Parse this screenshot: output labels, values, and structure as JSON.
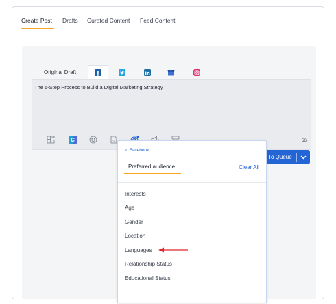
{
  "topnav": {
    "tabs": [
      "Create Post",
      "Drafts",
      "Curated Content",
      "Feed Content"
    ]
  },
  "composer": {
    "original_draft_label": "Original Draft",
    "networks": [
      "facebook-icon",
      "twitter-icon",
      "linkedin-icon",
      "google-my-business-icon",
      "instagram-icon"
    ],
    "post_text": "The 6-Step Process to Build a Digital Marketing Strategy",
    "char_count": "56",
    "toolbar_icons": [
      "media-icon",
      "canva-icon",
      "emoji-icon",
      "gif-icon",
      "target-audience-icon",
      "megaphone-icon",
      "hashtag-icon"
    ]
  },
  "queue_button": {
    "label": "To Queue"
  },
  "audience_dropdown": {
    "back_label": "Facebook",
    "title": "Preferred audience",
    "clear_label": "Clear All",
    "options": [
      "Interests",
      "Age",
      "Gender",
      "Location",
      "Languages",
      "Relationship Status",
      "Educational Status"
    ]
  },
  "colors": {
    "accent_orange": "#f5a623",
    "primary_blue": "#2465d6",
    "arrow_red": "#e0242b",
    "facebook_blue": "#1f5fa8",
    "twitter_blue": "#2aa4e6",
    "linkedin_blue": "#1b6ea3",
    "gmb_blue": "#3f6fd0",
    "instagram_pink": "#e1306c"
  }
}
